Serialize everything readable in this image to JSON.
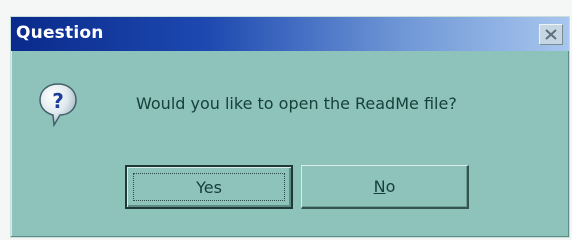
{
  "window": {
    "title": "Question",
    "close_icon": "close-icon"
  },
  "content": {
    "icon": "question-icon",
    "message": "Would you like to open the ReadMe file?"
  },
  "buttons": {
    "yes_label": "Yes",
    "no_first": "N",
    "no_rest": "o"
  },
  "colors": {
    "title_start": "#0a2a8c",
    "title_end": "#a8c6ee",
    "dialog_bg": "#8ec3bb",
    "text": "#17403b"
  }
}
